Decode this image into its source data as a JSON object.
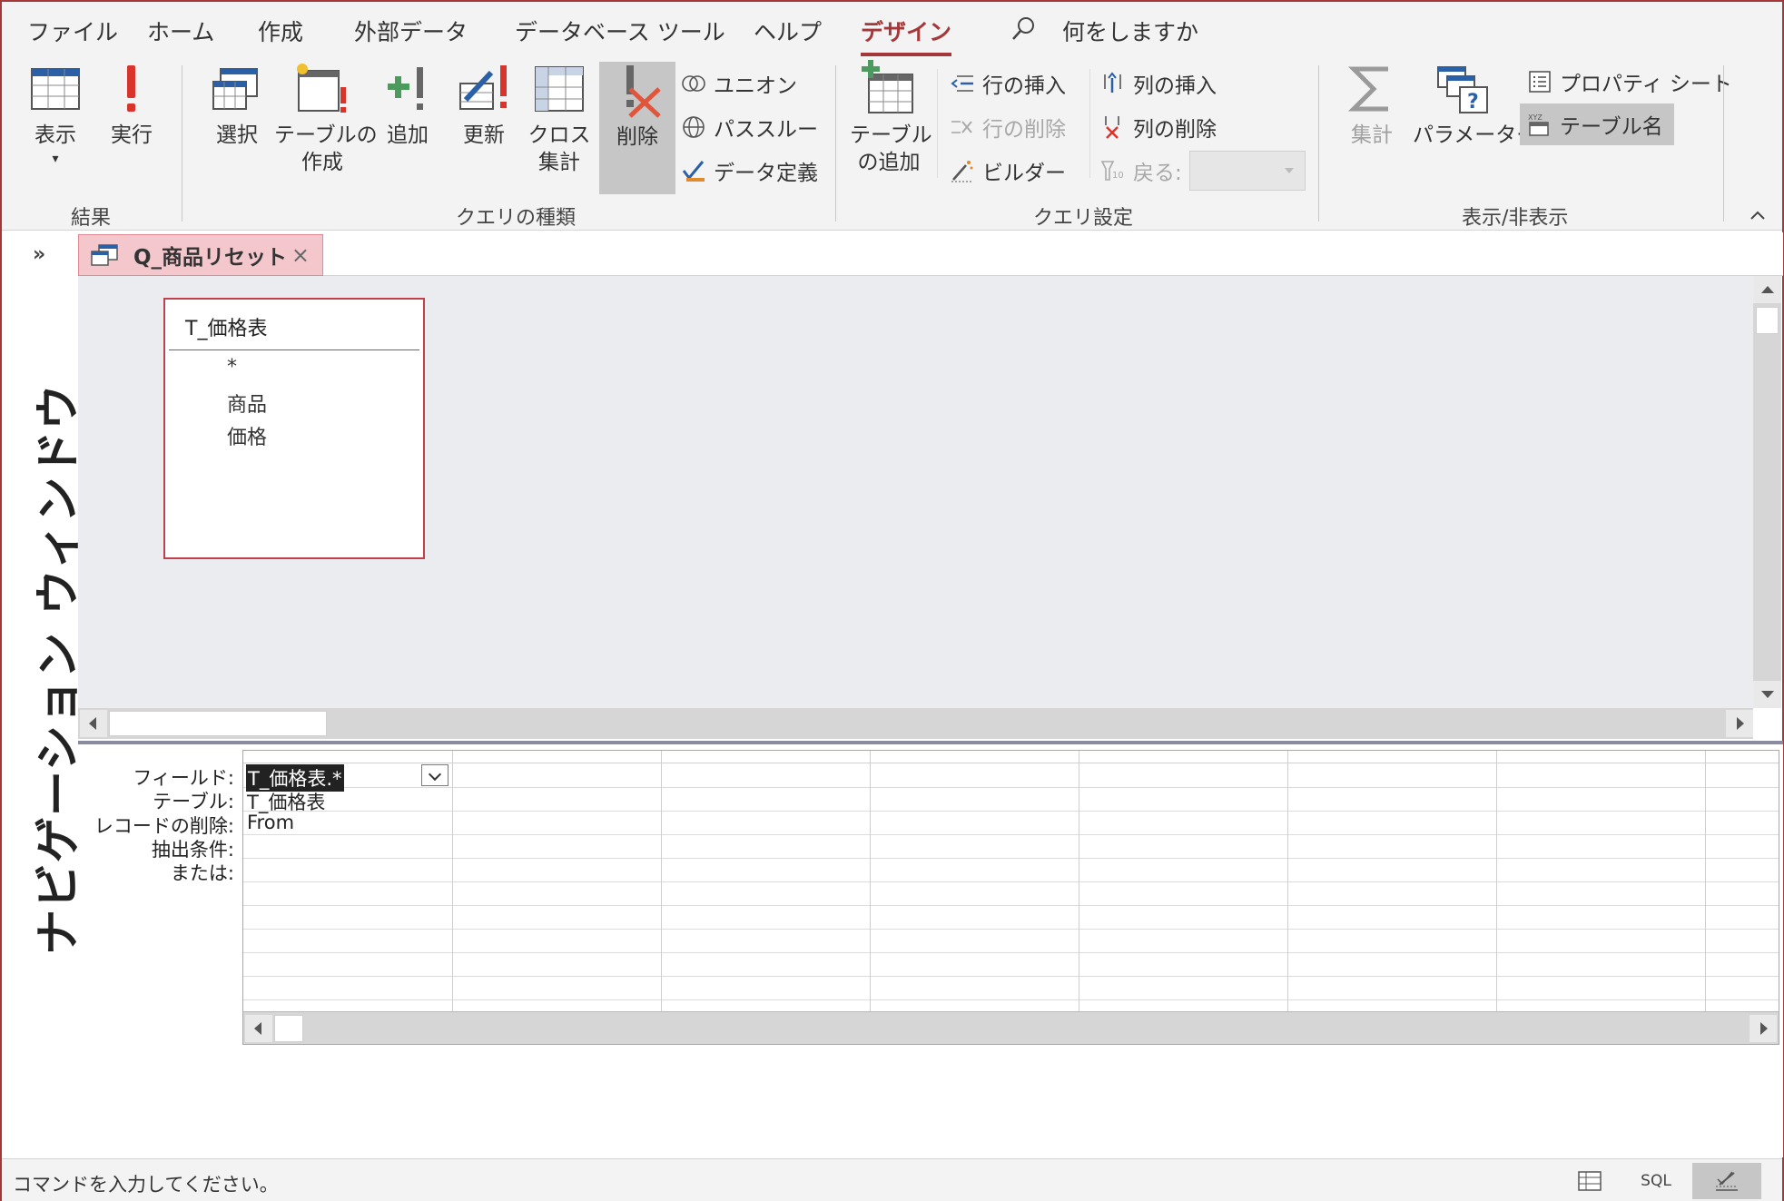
{
  "menu": {
    "tabs": [
      "ファイル",
      "ホーム",
      "作成",
      "外部データ",
      "データベース ツール",
      "ヘルプ",
      "デザイン"
    ],
    "search": "何をしますか"
  },
  "ribbon": {
    "results": {
      "view": "表示",
      "run": "実行",
      "group": "結果"
    },
    "query_type": {
      "select": "選択",
      "make_table_1": "テーブルの",
      "make_table_2": "作成",
      "append": "追加",
      "update": "更新",
      "crosstab_1": "クロス",
      "crosstab_2": "集計",
      "delete": "削除",
      "union": "ユニオン",
      "pass_through": "パススルー",
      "data_definition": "データ定義",
      "group": "クエリの種類"
    },
    "query_setup": {
      "add_table_1": "テーブル",
      "add_table_2": "の追加",
      "insert_rows": "行の挿入",
      "delete_rows": "行の削除",
      "builder": "ビルダー",
      "insert_columns": "列の挿入",
      "delete_columns": "列の削除",
      "return": "戻る:",
      "group": "クエリ設定"
    },
    "show_hide": {
      "totals": "集計",
      "parameters": "パラメーター",
      "property_sheet": "プロパティ シート",
      "table_names": "テーブル名",
      "group": "表示/非表示"
    }
  },
  "nav": {
    "toggle": "»",
    "title": "ナビゲーション ウィンドウ"
  },
  "doc_tab": {
    "name": "Q_商品リセット",
    "close": "×"
  },
  "table_box": {
    "title": "T_価格表",
    "fields": [
      "*",
      "商品",
      "価格"
    ]
  },
  "grid": {
    "row_labels": [
      "フィールド:",
      "テーブル:",
      "レコードの削除:",
      "抽出条件:",
      "または:"
    ],
    "col1": {
      "field": "T_価格表.*",
      "table": "T_価格表",
      "delete": "From"
    }
  },
  "status": {
    "text": "コマンドを入力してください。",
    "sql": "SQL"
  },
  "colors": {
    "accent": "#a4373a",
    "tab_bg": "#f4c7cc",
    "ribbon_bg": "#f3f3f3"
  }
}
